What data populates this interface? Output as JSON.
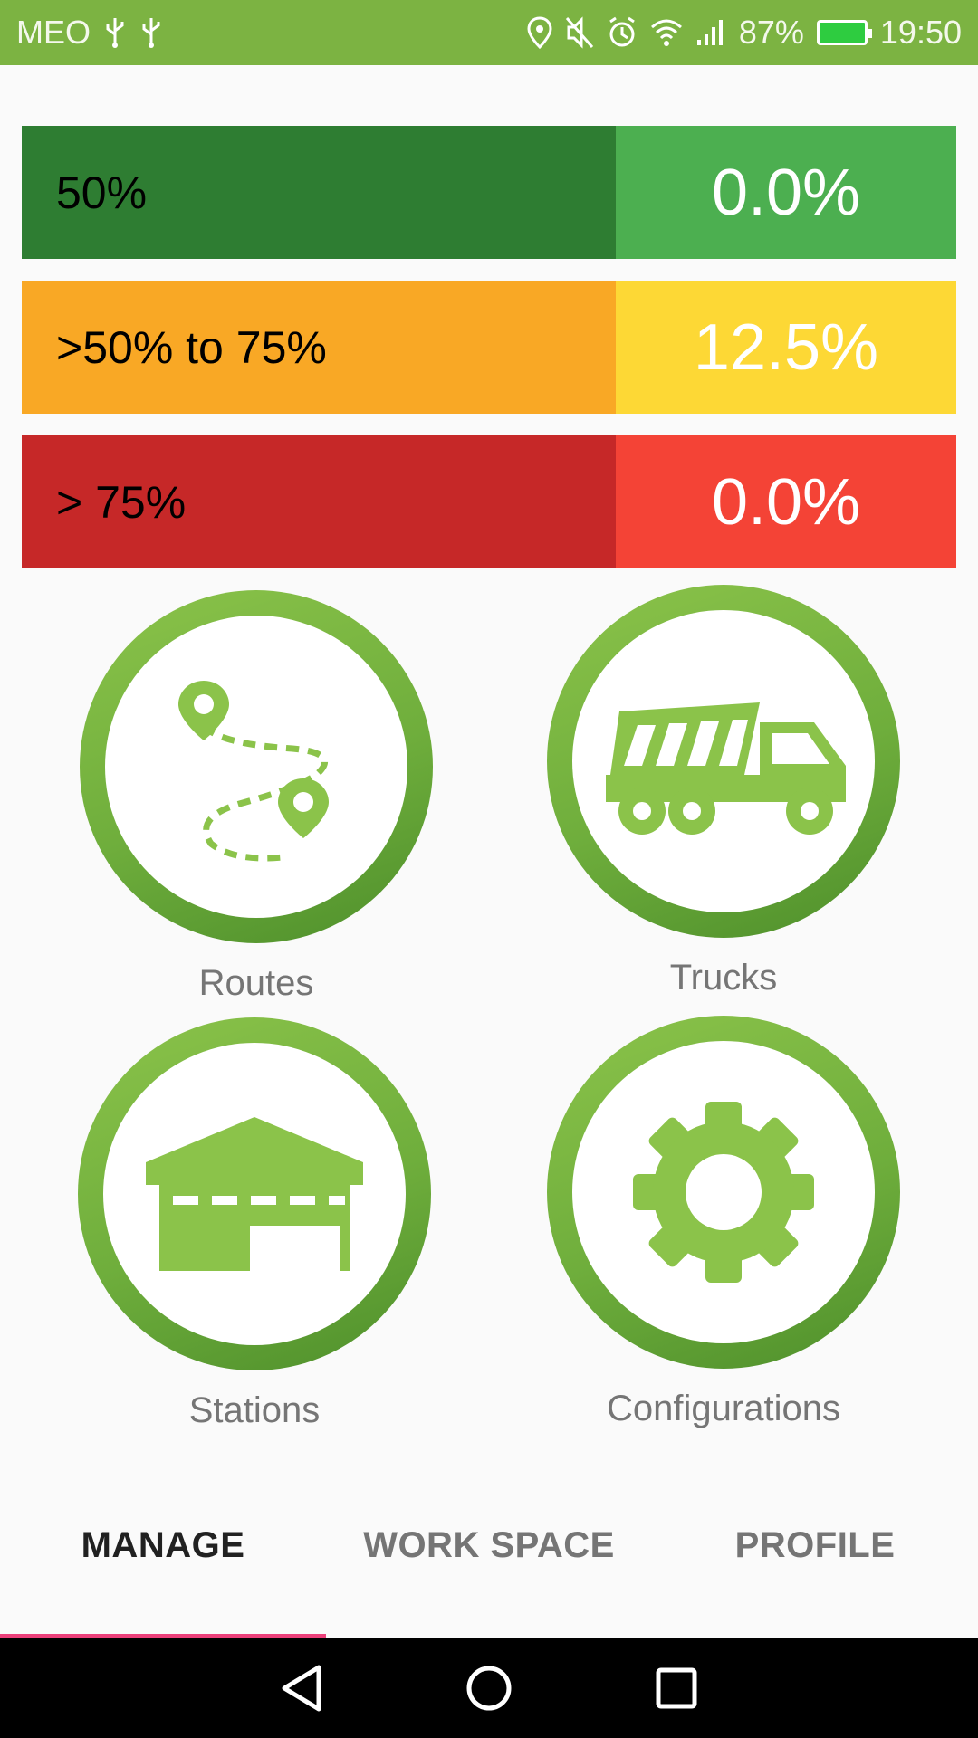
{
  "status_bar": {
    "carrier": "MEO",
    "battery_percent": "87%",
    "time": "19:50",
    "icons": [
      "usb-icon",
      "usb-icon",
      "location-icon",
      "mute-icon",
      "alarm-icon",
      "wifi-icon",
      "signal-icon",
      "battery-charging-icon"
    ]
  },
  "levels": [
    {
      "label": "50%",
      "value": "0.0%",
      "label_color": "#2e7d32",
      "value_color": "#4caf50"
    },
    {
      "label": ">50% to  75%",
      "value": "12.5%",
      "label_color": "#f9a825",
      "value_color": "#fdd835"
    },
    {
      "label": "> 75%",
      "value": "0.0%",
      "label_color": "#c62828",
      "value_color": "#f44336"
    }
  ],
  "menu": [
    {
      "label": "Routes",
      "icon": "route-map-icon"
    },
    {
      "label": "Trucks",
      "icon": "dump-truck-icon"
    },
    {
      "label": "Stations",
      "icon": "warehouse-icon"
    },
    {
      "label": "Configurations",
      "icon": "gear-icon"
    }
  ],
  "tabs": [
    {
      "label": "MANAGE",
      "active": true
    },
    {
      "label": "WORK SPACE",
      "active": false
    },
    {
      "label": "PROFILE",
      "active": false
    }
  ],
  "colors": {
    "status_bar": "#7cb342",
    "accent": "#ec407a",
    "icon_green": "#8bc34a"
  }
}
